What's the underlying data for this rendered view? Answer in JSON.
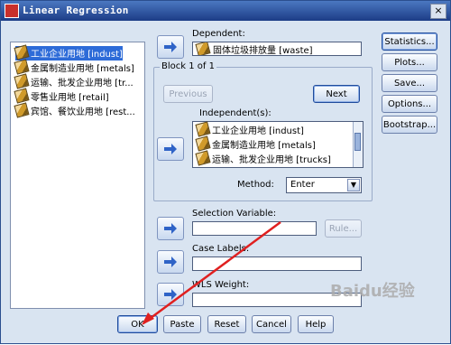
{
  "window": {
    "title": "Linear Regression",
    "close_glyph": "×"
  },
  "variables": [
    "工业企业用地 [indust]",
    "金属制造业用地 [metals]",
    "运输、批发企业用地 [tr...",
    "零售业用地 [retail]",
    "宾馆、餐饮业用地 [rest..."
  ],
  "dependent": {
    "label": "Dependent:",
    "value": "固体垃圾排放量 [waste]"
  },
  "block": {
    "title": "Block 1 of 1",
    "previous_label": "Previous",
    "next_label": "Next"
  },
  "independent": {
    "label": "Independent(s):",
    "items": [
      "工业企业用地 [indust]",
      "金属制造业用地 [metals]",
      "运输、批发企业用地 [trucks]"
    ]
  },
  "method": {
    "label": "Method:",
    "value": "Enter",
    "dropdown_glyph": "▼"
  },
  "selection": {
    "label": "Selection Variable:",
    "rule_label": "Rule..."
  },
  "case_labels": {
    "label": "Case Labels:"
  },
  "wls": {
    "label": "WLS Weight:"
  },
  "side_buttons": [
    "Statistics...",
    "Plots...",
    "Save...",
    "Options...",
    "Bootstrap..."
  ],
  "bottom_buttons": [
    "OK",
    "Paste",
    "Reset",
    "Cancel",
    "Help"
  ],
  "watermark": "Baidu经验"
}
